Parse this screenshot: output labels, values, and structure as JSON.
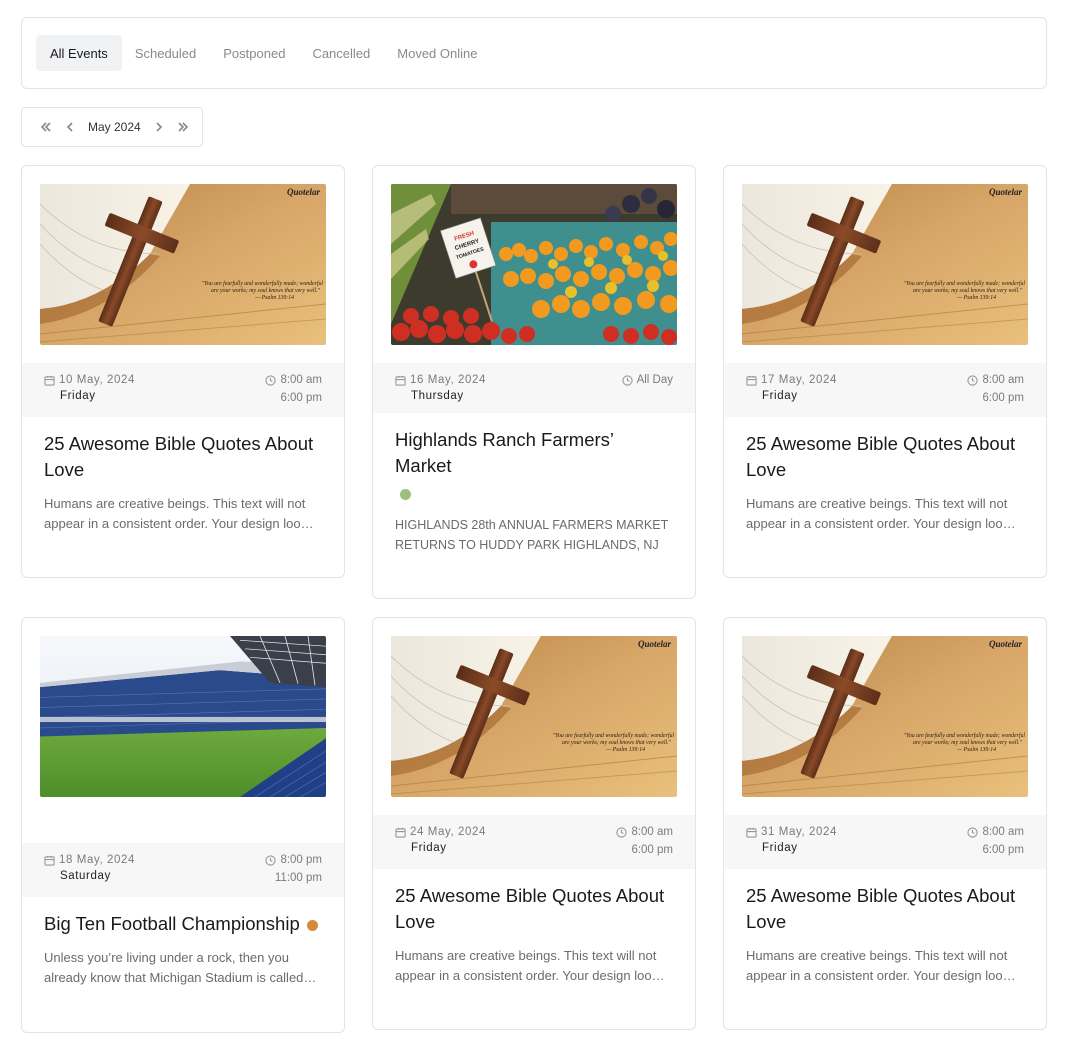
{
  "filters": {
    "tabs": [
      "All Events",
      "Scheduled",
      "Postponed",
      "Cancelled",
      "Moved Online"
    ],
    "active": "All Events"
  },
  "month_nav": {
    "label": "May 2024"
  },
  "events": [
    {
      "image": "bible-cross-quote-image",
      "date": "10 May, 2024",
      "day": "Friday",
      "time_start": "8:00 am",
      "time_end": "6:00 pm",
      "title": "25 Awesome Bible Quotes About Love",
      "description": "Humans are creative beings. This text will not appear in a consistent order. Your design looks more interesting than it actually is."
    },
    {
      "image": "farmers-market-image",
      "date": "16 May, 2024",
      "day": "Thursday",
      "time_start": "All Day",
      "time_end": "",
      "title": "Highlands Ranch Farmers’ Market",
      "status_color": "#9dc07b",
      "description": "HIGHLANDS 28th ANNUAL FARMERS MARKET RETURNS TO HUDDY PARK HIGHLANDS, NJ"
    },
    {
      "image": "bible-cross-quote-image",
      "date": "17 May, 2024",
      "day": "Friday",
      "time_start": "8:00 am",
      "time_end": "6:00 pm",
      "title": "25 Awesome Bible Quotes About Love",
      "description": "Humans are creative beings. This text will not appear in a consistent order. Your design looks more interesting than it actually is."
    },
    {
      "image": "football-stadium-image",
      "date": "18 May, 2024",
      "day": "Saturday",
      "time_start": "8:00 pm",
      "time_end": "11:00 pm",
      "title": "Big Ten Football Championship",
      "status_color": "#d4893a",
      "description": "Unless you’re living under a rock, then you already know that Michigan Stadium is called the Big House."
    },
    {
      "image": "bible-cross-quote-image",
      "date": "24 May, 2024",
      "day": "Friday",
      "time_start": "8:00 am",
      "time_end": "6:00 pm",
      "title": "25 Awesome Bible Quotes About Love",
      "description": "Humans are creative beings. This text will not appear in a consistent order. Your design looks more interesting than it actually is."
    },
    {
      "image": "bible-cross-quote-image",
      "date": "31 May, 2024",
      "day": "Friday",
      "time_start": "8:00 am",
      "time_end": "6:00 pm",
      "title": "25 Awesome Bible Quotes About Love",
      "description": "Humans are creative beings. This text will not appear in a consistent order. Your design looks more interesting than it actually is."
    }
  ],
  "image_text": {
    "brand": "Quotelar",
    "quote_line1": "\"You are fearfully and wonderfully made; wonderful",
    "quote_line2": "are your works; my soul knows that very well.\"",
    "quote_ref": "— Psalm 139:14",
    "sign_line1": "FRESH",
    "sign_line2": "CHERRY",
    "sign_line3": "TOMATOES"
  }
}
